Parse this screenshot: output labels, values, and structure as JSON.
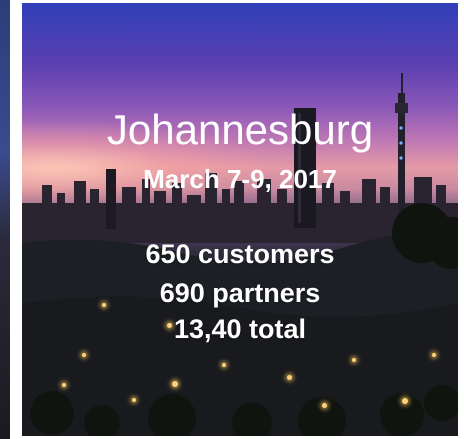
{
  "banner": {
    "city": "Johannesburg",
    "dates": "March 7-9, 2017",
    "stats": [
      "650 customers",
      "690 partners",
      "13,40 total"
    ],
    "background": "city-skyline-dusk-photo"
  },
  "colors": {
    "text": "#ffffff",
    "sky_top": "#2f3fb8",
    "sky_mid": "#c079b4",
    "horizon": "#e59aa6",
    "city_dark": "#1f2026"
  }
}
